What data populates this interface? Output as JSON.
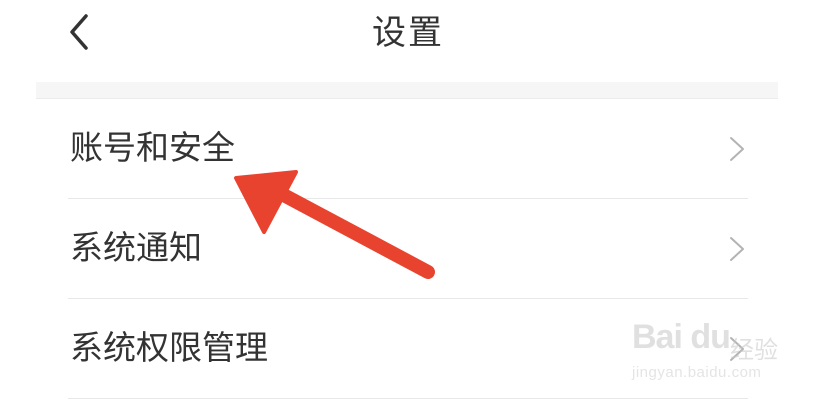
{
  "header": {
    "title": "设置",
    "back_icon": "chevron-left-icon"
  },
  "settings": {
    "items": [
      {
        "label": "账号和安全",
        "icon": "chevron-right-icon"
      },
      {
        "label": "系统通知",
        "icon": "chevron-right-icon"
      },
      {
        "label": "系统权限管理",
        "icon": "chevron-right-icon"
      }
    ]
  },
  "annotation": {
    "color": "#e8432e",
    "points_to": "账号和安全"
  },
  "watermark": {
    "brand": "Bai du",
    "suffix": "经验",
    "url": "jingyan.baidu.com"
  }
}
